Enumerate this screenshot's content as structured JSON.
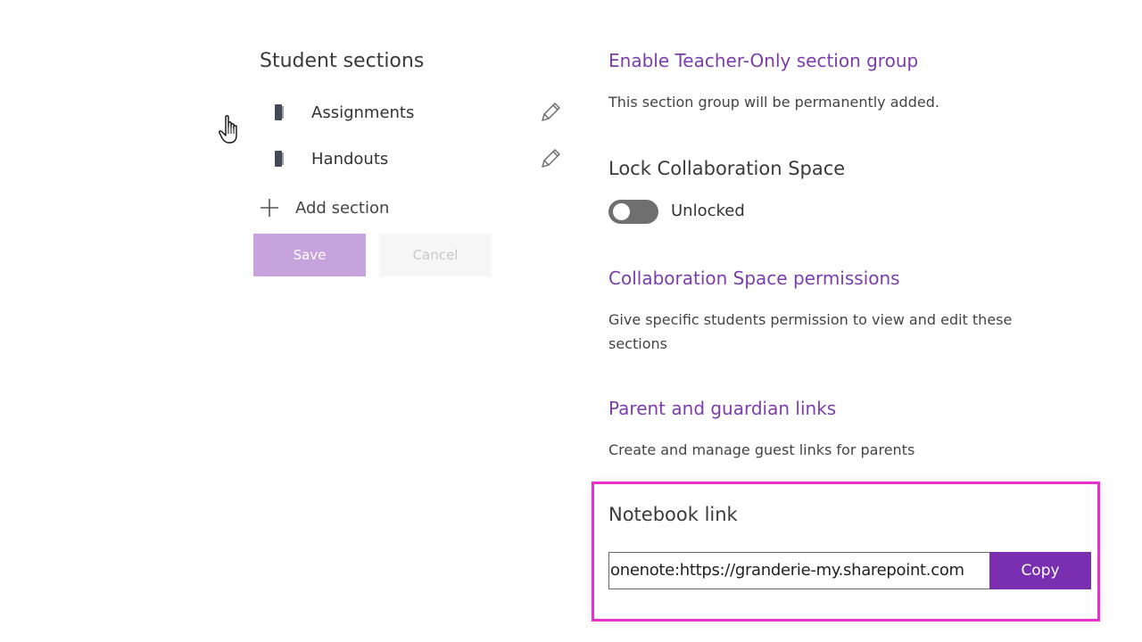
{
  "student_sections": {
    "title": "Student sections",
    "items": [
      {
        "label": "Assignments"
      },
      {
        "label": "Handouts"
      }
    ],
    "add_label": "Add section",
    "save_label": "Save",
    "cancel_label": "Cancel"
  },
  "teacher_only": {
    "heading": "Enable Teacher-Only section group",
    "description": "This section group will be permanently added."
  },
  "lock_space": {
    "heading": "Lock Collaboration Space",
    "toggle_state": "Unlocked",
    "toggle_on": false
  },
  "collab_permissions": {
    "heading": "Collaboration Space permissions",
    "description": "Give specific students permission to view and edit these sections"
  },
  "parent_links": {
    "heading": "Parent and guardian links",
    "description": "Create and manage guest links for parents"
  },
  "notebook_link": {
    "heading": "Notebook link",
    "value": "onenote:https://granderie-my.sharepoint.com",
    "copy_label": "Copy"
  },
  "colors": {
    "accent_purple": "#7a2fb0",
    "link_purple": "#7b3dac",
    "save_disabled": "#c7a3de",
    "highlight_pink": "#ea2fd0"
  }
}
